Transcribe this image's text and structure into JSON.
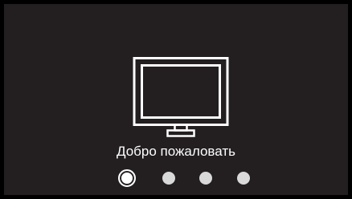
{
  "welcome": {
    "text": "Добро пожаловать"
  },
  "pager": {
    "total": 4,
    "active_index": 0
  },
  "icons": {
    "hero": "monitor-icon"
  },
  "colors": {
    "background": "#231f20",
    "frame": "#000000",
    "foreground": "#ffffff",
    "inactive_dot": "#d9d9d9"
  }
}
